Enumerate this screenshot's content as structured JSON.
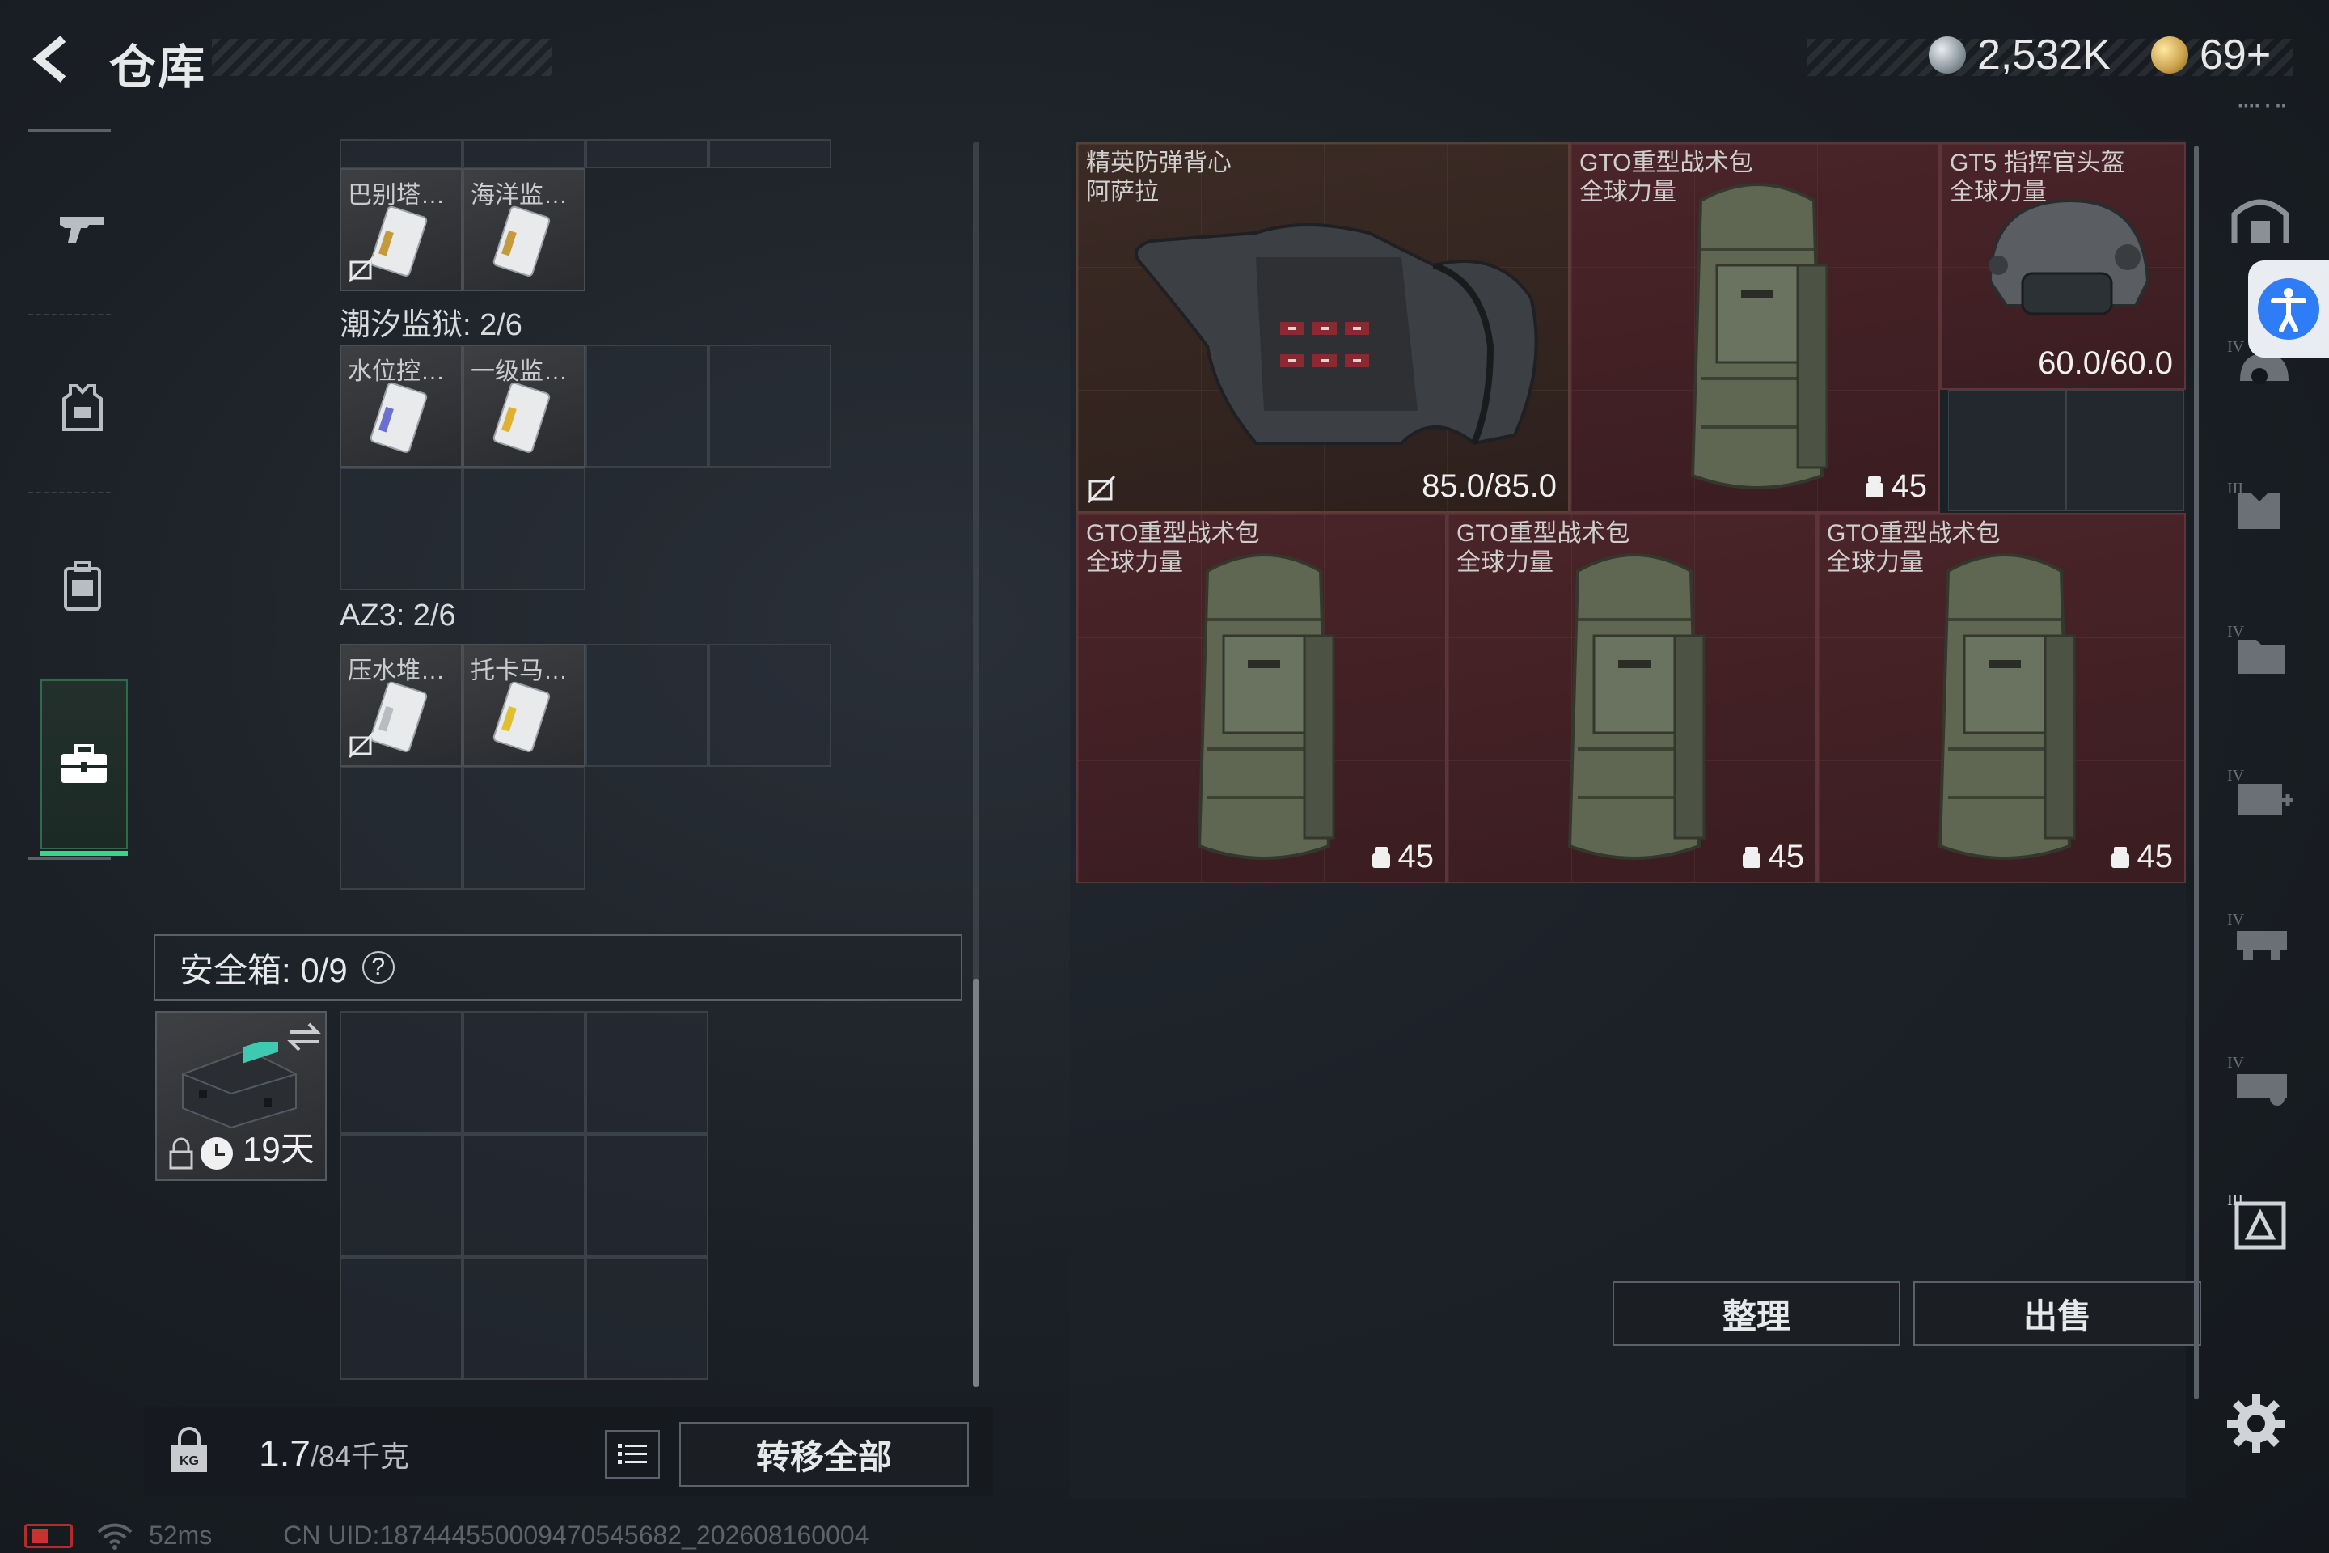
{
  "header": {
    "title": "仓库",
    "currency_silver": "2,532K",
    "currency_gold": "69+",
    "tiny_hash": "▪▪▪▪ ▪ ▪▪"
  },
  "left_panel": {
    "top_row_items": [
      {
        "name": "巴别塔…"
      },
      {
        "name": "海洋监…"
      }
    ],
    "sections": [
      {
        "label": "潮汐监狱: 2/6",
        "items": [
          {
            "name": "水位控…"
          },
          {
            "name": "一级监…"
          }
        ]
      },
      {
        "label": "AZ3: 2/6",
        "items": [
          {
            "name": "压水堆…"
          },
          {
            "name": "托卡马…"
          }
        ]
      }
    ],
    "safe_box": {
      "header": "安全箱: 0/9",
      "help": "?",
      "days": "19天"
    },
    "weight": {
      "current": "1.7",
      "max": "/84千克"
    },
    "transfer_all": "转移全部"
  },
  "right_panel": {
    "items": [
      {
        "name_line1": "精英防弹背心",
        "name_line2": "阿萨拉",
        "durability": "85.0/85.0"
      },
      {
        "name_line1": "GTO重型战术包",
        "name_line2": "全球力量",
        "level": "45"
      },
      {
        "name_line1": "GT5 指挥官头盔",
        "name_line2": "全球力量",
        "durability": "60.0/60.0"
      },
      {
        "name_line1": "GTO重型战术包",
        "name_line2": "全球力量",
        "level": "45"
      },
      {
        "name_line1": "GTO重型战术包",
        "name_line2": "全球力量",
        "level": "45"
      },
      {
        "name_line1": "GTO重型战术包",
        "name_line2": "全球力量",
        "level": "45"
      }
    ],
    "sort_label": "整理",
    "sell_label": "出售"
  },
  "status": {
    "ping": "52ms",
    "uid": "CN UID:187444550009470545682_202608160004"
  },
  "colors": {
    "accent_green": "#37d68a",
    "item_bg_red": "#4a2428",
    "access_blue": "#2e7cf6"
  }
}
